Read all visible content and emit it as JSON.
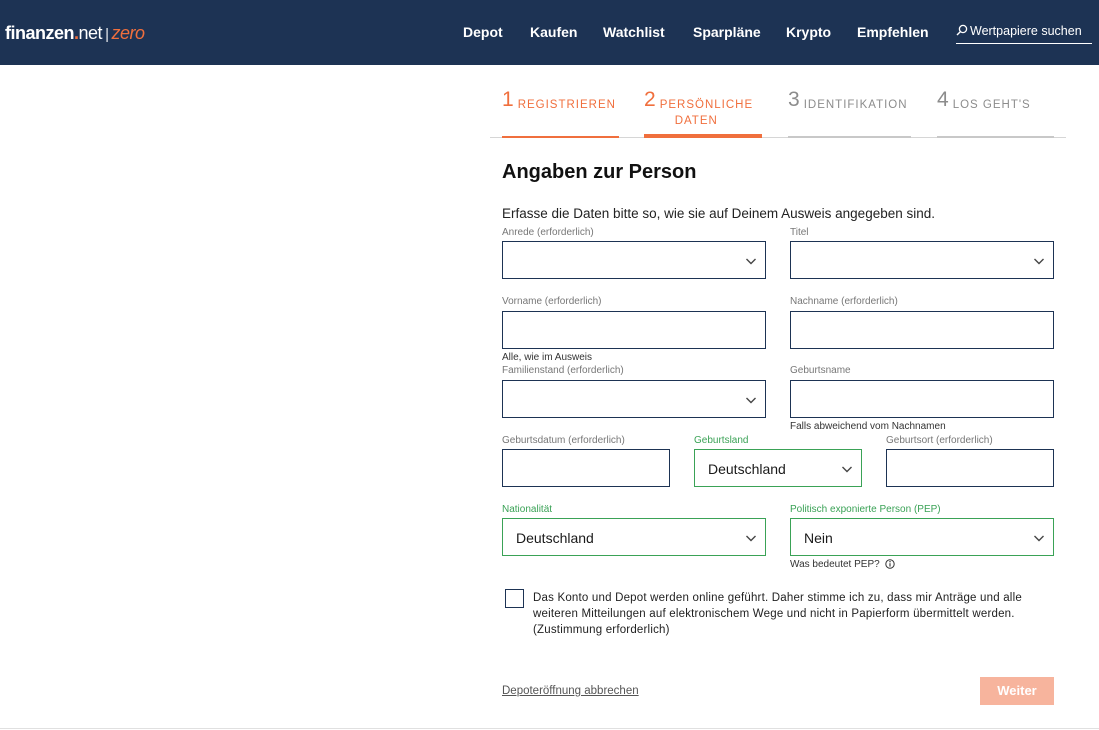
{
  "header": {
    "logo": {
      "brand": "finanzen",
      "dot": ".",
      "net": "net",
      "sep": "|",
      "product": "zero"
    },
    "nav": [
      "Depot",
      "Kaufen",
      "Watchlist",
      "Sparpläne",
      "Krypto",
      "Empfehlen"
    ],
    "search": {
      "icon": "search-icon",
      "label": "Wertpapiere suchen"
    }
  },
  "steps": [
    {
      "num": "1",
      "label": "Registrieren",
      "state": "done"
    },
    {
      "num": "2",
      "label_line1": "Persönliche",
      "label_line2": "Daten",
      "state": "active"
    },
    {
      "num": "3",
      "label": "Identifikation",
      "state": "inactive"
    },
    {
      "num": "4",
      "label": "Los geht's",
      "state": "inactive"
    }
  ],
  "form": {
    "title": "Angaben zur Person",
    "intro": "Erfasse die Daten bitte so, wie sie auf Deinem Ausweis angegeben sind.",
    "anrede": {
      "label": "Anrede (erforderlich)",
      "value": ""
    },
    "titel": {
      "label": "Titel",
      "value": ""
    },
    "vorname": {
      "label": "Vorname (erforderlich)",
      "value": "",
      "hint": "Alle, wie im Ausweis"
    },
    "nachname": {
      "label": "Nachname (erforderlich)",
      "value": ""
    },
    "familienstand": {
      "label": "Familienstand (erforderlich)",
      "value": ""
    },
    "geburtsname": {
      "label": "Geburtsname",
      "value": "",
      "hint": "Falls abweichend vom Nachnamen"
    },
    "geburtsdatum": {
      "label": "Geburtsdatum (erforderlich)",
      "value": ""
    },
    "geburtsland": {
      "label": "Geburtsland",
      "value": "Deutschland"
    },
    "geburtsort": {
      "label": "Geburtsort (erforderlich)",
      "value": ""
    },
    "nationalitaet": {
      "label": "Nationalität",
      "value": "Deutschland"
    },
    "pep": {
      "label": "Politisch exponierte Person (PEP)",
      "value": "Nein",
      "hint": "Was bedeutet PEP?"
    },
    "consent": "Das Konto und Depot werden online geführt. Daher stimme ich zu, dass mir Anträge und alle weiteren Mitteilungen auf elektronischem Wege und nicht in Papierform übermittelt werden. (Zustimmung erforderlich)",
    "cancel": "Depoteröffnung abbrechen",
    "next": "Weiter"
  },
  "colors": {
    "header_bg": "#1d3354",
    "accent": "#f06f3d",
    "valid": "#3aa256",
    "button_disabled": "#f7b49d"
  }
}
